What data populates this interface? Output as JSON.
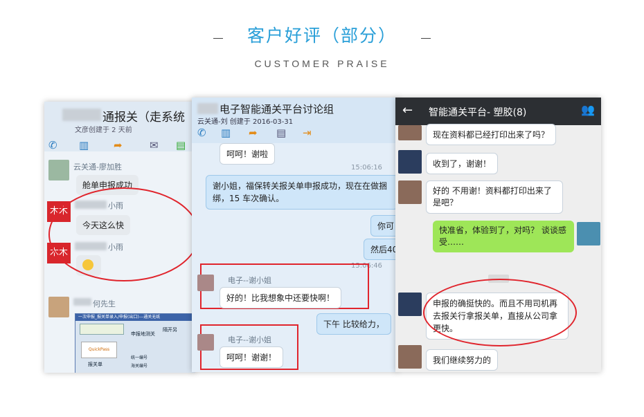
{
  "header": {
    "title": "客户好评（部分）",
    "subtitle": "CUSTOMER PRAISE"
  },
  "panel1": {
    "title": "通报关（走系统",
    "created": "文彦创建于 2 天前",
    "messages": [
      {
        "sender": "云关通-廖加胜",
        "text": "舱单申报成功"
      },
      {
        "sender": "小雨",
        "text": "今天这么快"
      },
      {
        "sender": "小雨",
        "text": ""
      },
      {
        "sender": "何先生",
        "text": ""
      }
    ],
    "screenshot": {
      "label_top": "一次申报_报关单录入/申报(出口)---通关无纸",
      "btn1": "申报地测关",
      "btn2": "隔开另",
      "logo": "QuickPass",
      "label": "报关单",
      "row1": "统一编号",
      "row2": "海关编号"
    }
  },
  "panel2": {
    "title": "电子智能通关平台讨论组",
    "created": "云关通-刘    创建于 2016-03-31",
    "messages": [
      {
        "type": "in",
        "text": "呵呵！谢啦"
      },
      {
        "type": "ts",
        "text": "15:06:16"
      },
      {
        "type": "out",
        "text": "谢小姐，福保转关报关单申报成功，现在在做捆绑，15 车次确认。"
      },
      {
        "type": "out",
        "text": "你可"
      },
      {
        "type": "out",
        "text": "然后40"
      },
      {
        "type": "ts",
        "text": "15:06:46"
      },
      {
        "type": "in",
        "sender": "电子--谢小姐",
        "text": "好的！比我想象中还要快啊！"
      },
      {
        "type": "out",
        "text": "下午     比较给力，"
      },
      {
        "type": "in",
        "sender": "电子--谢小姐",
        "text": "呵呵！谢谢！"
      }
    ]
  },
  "panel3": {
    "title": "智能通关平台-     塑胶(8)",
    "messages": [
      {
        "side": "left",
        "text": "现在资料都已经打印出来了吗？"
      },
      {
        "side": "left",
        "text": "收到了，谢谢！"
      },
      {
        "side": "left",
        "text": "好的 不用谢！资料都打印出来了 是吧？"
      },
      {
        "side": "right",
        "text": "快准省，体验到了，对吗？ 谈谈感受……"
      },
      {
        "side": "left",
        "text": "申报的确挺快的。而且不用司机再去报关行拿报关单，直接从公司拿更快。"
      },
      {
        "side": "left",
        "text": "我们继续努力的"
      }
    ]
  },
  "colors": {
    "accent": "#2a9fd8",
    "red": "#e0242c"
  },
  "icons": [
    "phone-icon",
    "chart-icon",
    "folder-icon",
    "mail-icon",
    "chat-icon",
    "back-arrow-icon",
    "group-icon"
  ]
}
